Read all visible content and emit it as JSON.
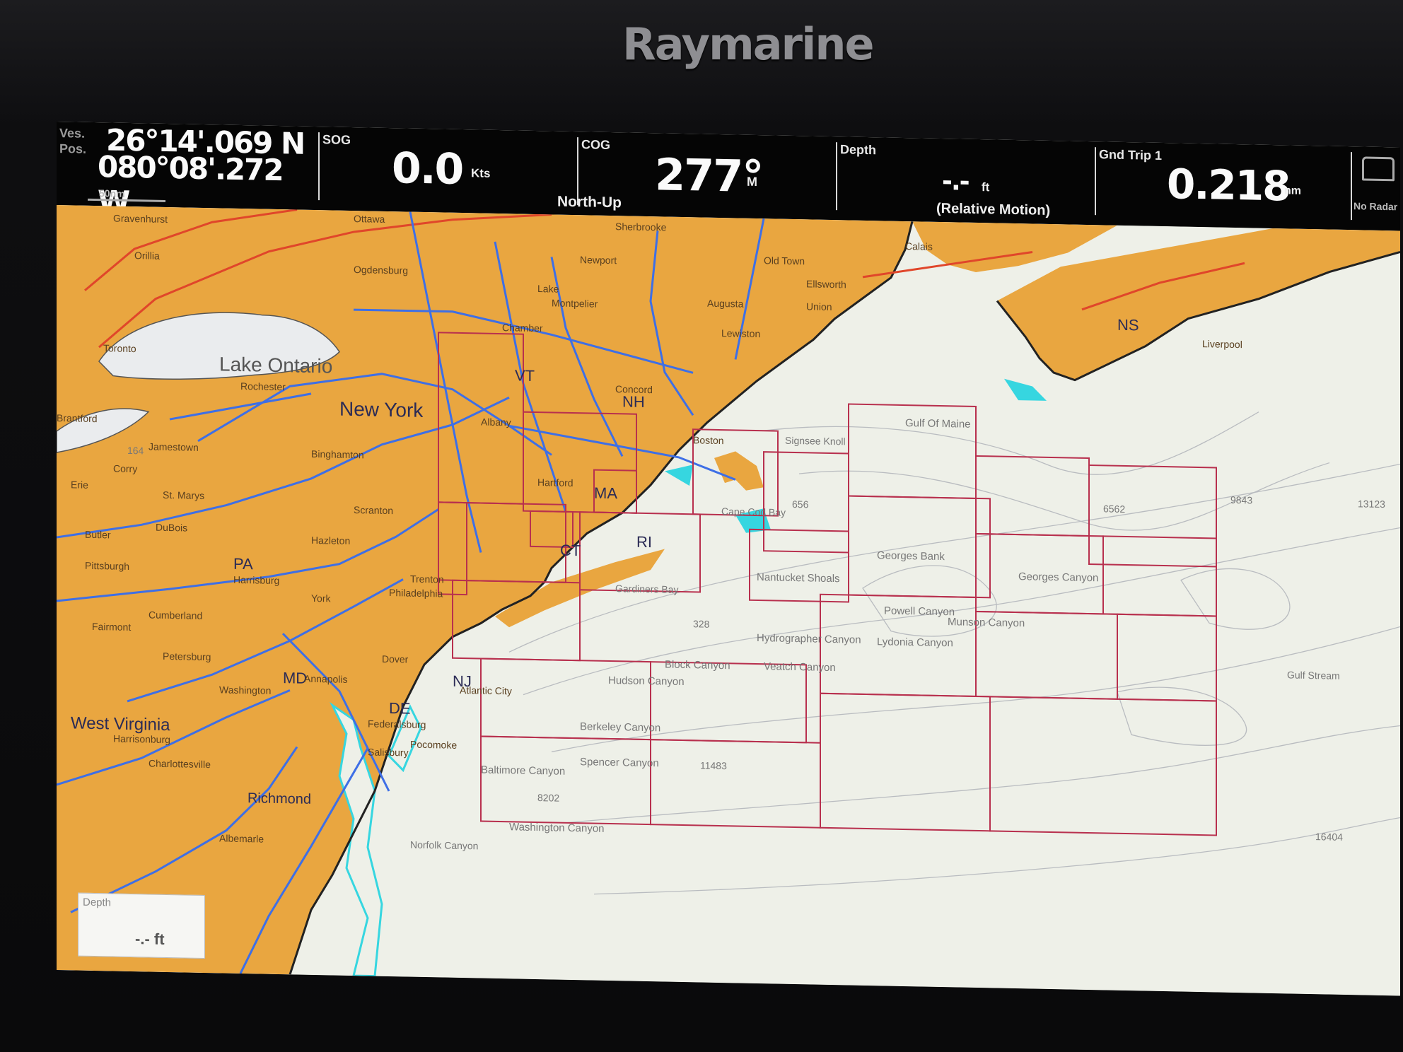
{
  "device": {
    "brand": "Raymarine"
  },
  "databar": {
    "position": {
      "label_vs": "Ves.",
      "label_pos": "Pos.",
      "lat": "26°14'.069 N",
      "lon": "080°08'.272 W",
      "scale": "50nm"
    },
    "sog": {
      "label": "SOG",
      "value": "0.0",
      "unit": "Kts"
    },
    "cog": {
      "label": "COG",
      "value": "277°",
      "unit": "M",
      "orientation": "North-Up"
    },
    "depth": {
      "label": "Depth",
      "value": "-.-",
      "unit": "ft",
      "motion": "(Relative Motion)"
    },
    "trip": {
      "label": "Gnd Trip 1",
      "value": "0.218",
      "unit": "nm"
    },
    "radar": {
      "label": "No Radar"
    }
  },
  "depth_box": {
    "label": "Depth",
    "value": "-.- ft"
  },
  "colors": {
    "land": "#e9a640",
    "sea": "#eef0e8",
    "roads": "#3e6fe6",
    "highways": "#e0462a",
    "chart_grid": "#b8304e",
    "shallow": "#36d6e0"
  },
  "map_labels": {
    "states": [
      "New York",
      "VT",
      "NH",
      "MA",
      "CT",
      "RI",
      "PA",
      "NJ",
      "DE",
      "MD",
      "West Virginia",
      "NS"
    ],
    "water": [
      "Lake Ontario",
      "Gulf Of Maine",
      "Georges Bank",
      "Nantucket Shoals",
      "Gardiners Bay",
      "Cape Cod Bay"
    ],
    "canyons": [
      "Hudson Canyon",
      "Block Canyon",
      "Veatch Canyon",
      "Hydrographer Canyon",
      "Lydonia Canyon",
      "Powell Canyon",
      "Munson Canyon",
      "Georges Canyon",
      "Berkeley Canyon",
      "Spencer Canyon",
      "Baltimore Canyon",
      "Washington Canyon",
      "Norfolk Canyon"
    ],
    "cities": [
      "Gravenhurst",
      "Orillia",
      "Ottawa",
      "Sherbrooke",
      "Ogdensburg",
      "Newport",
      "Lake",
      "Montpelier",
      "Old Town",
      "Ellsworth",
      "Augusta",
      "Union",
      "Lewiston",
      "Calais",
      "Liverpool",
      "Rochester",
      "Albany",
      "Concord",
      "Boston",
      "Binghamton",
      "Jamestown",
      "Corry",
      "St. Marys",
      "DuBois",
      "Butler",
      "Pittsburgh",
      "Scranton",
      "Hazleton",
      "Hartford",
      "Trenton",
      "Philadelphia",
      "Harrisburg",
      "York",
      "Cumberland",
      "Fairmont",
      "Petersburg",
      "Harrisonburg",
      "Charlottesville",
      "Washington",
      "Annapolis",
      "Dover",
      "Federalsburg",
      "Salisbury",
      "Pocomoke",
      "Richmond",
      "Atlantic City",
      "Toronto",
      "Brantford",
      "Erie",
      "Albemarle",
      "Signsee Knoll",
      "Chamber"
    ],
    "depths": [
      "164",
      "328",
      "656",
      "6562",
      "9843",
      "11483",
      "8202",
      "16404",
      "13123",
      "Gulf Stream"
    ]
  }
}
